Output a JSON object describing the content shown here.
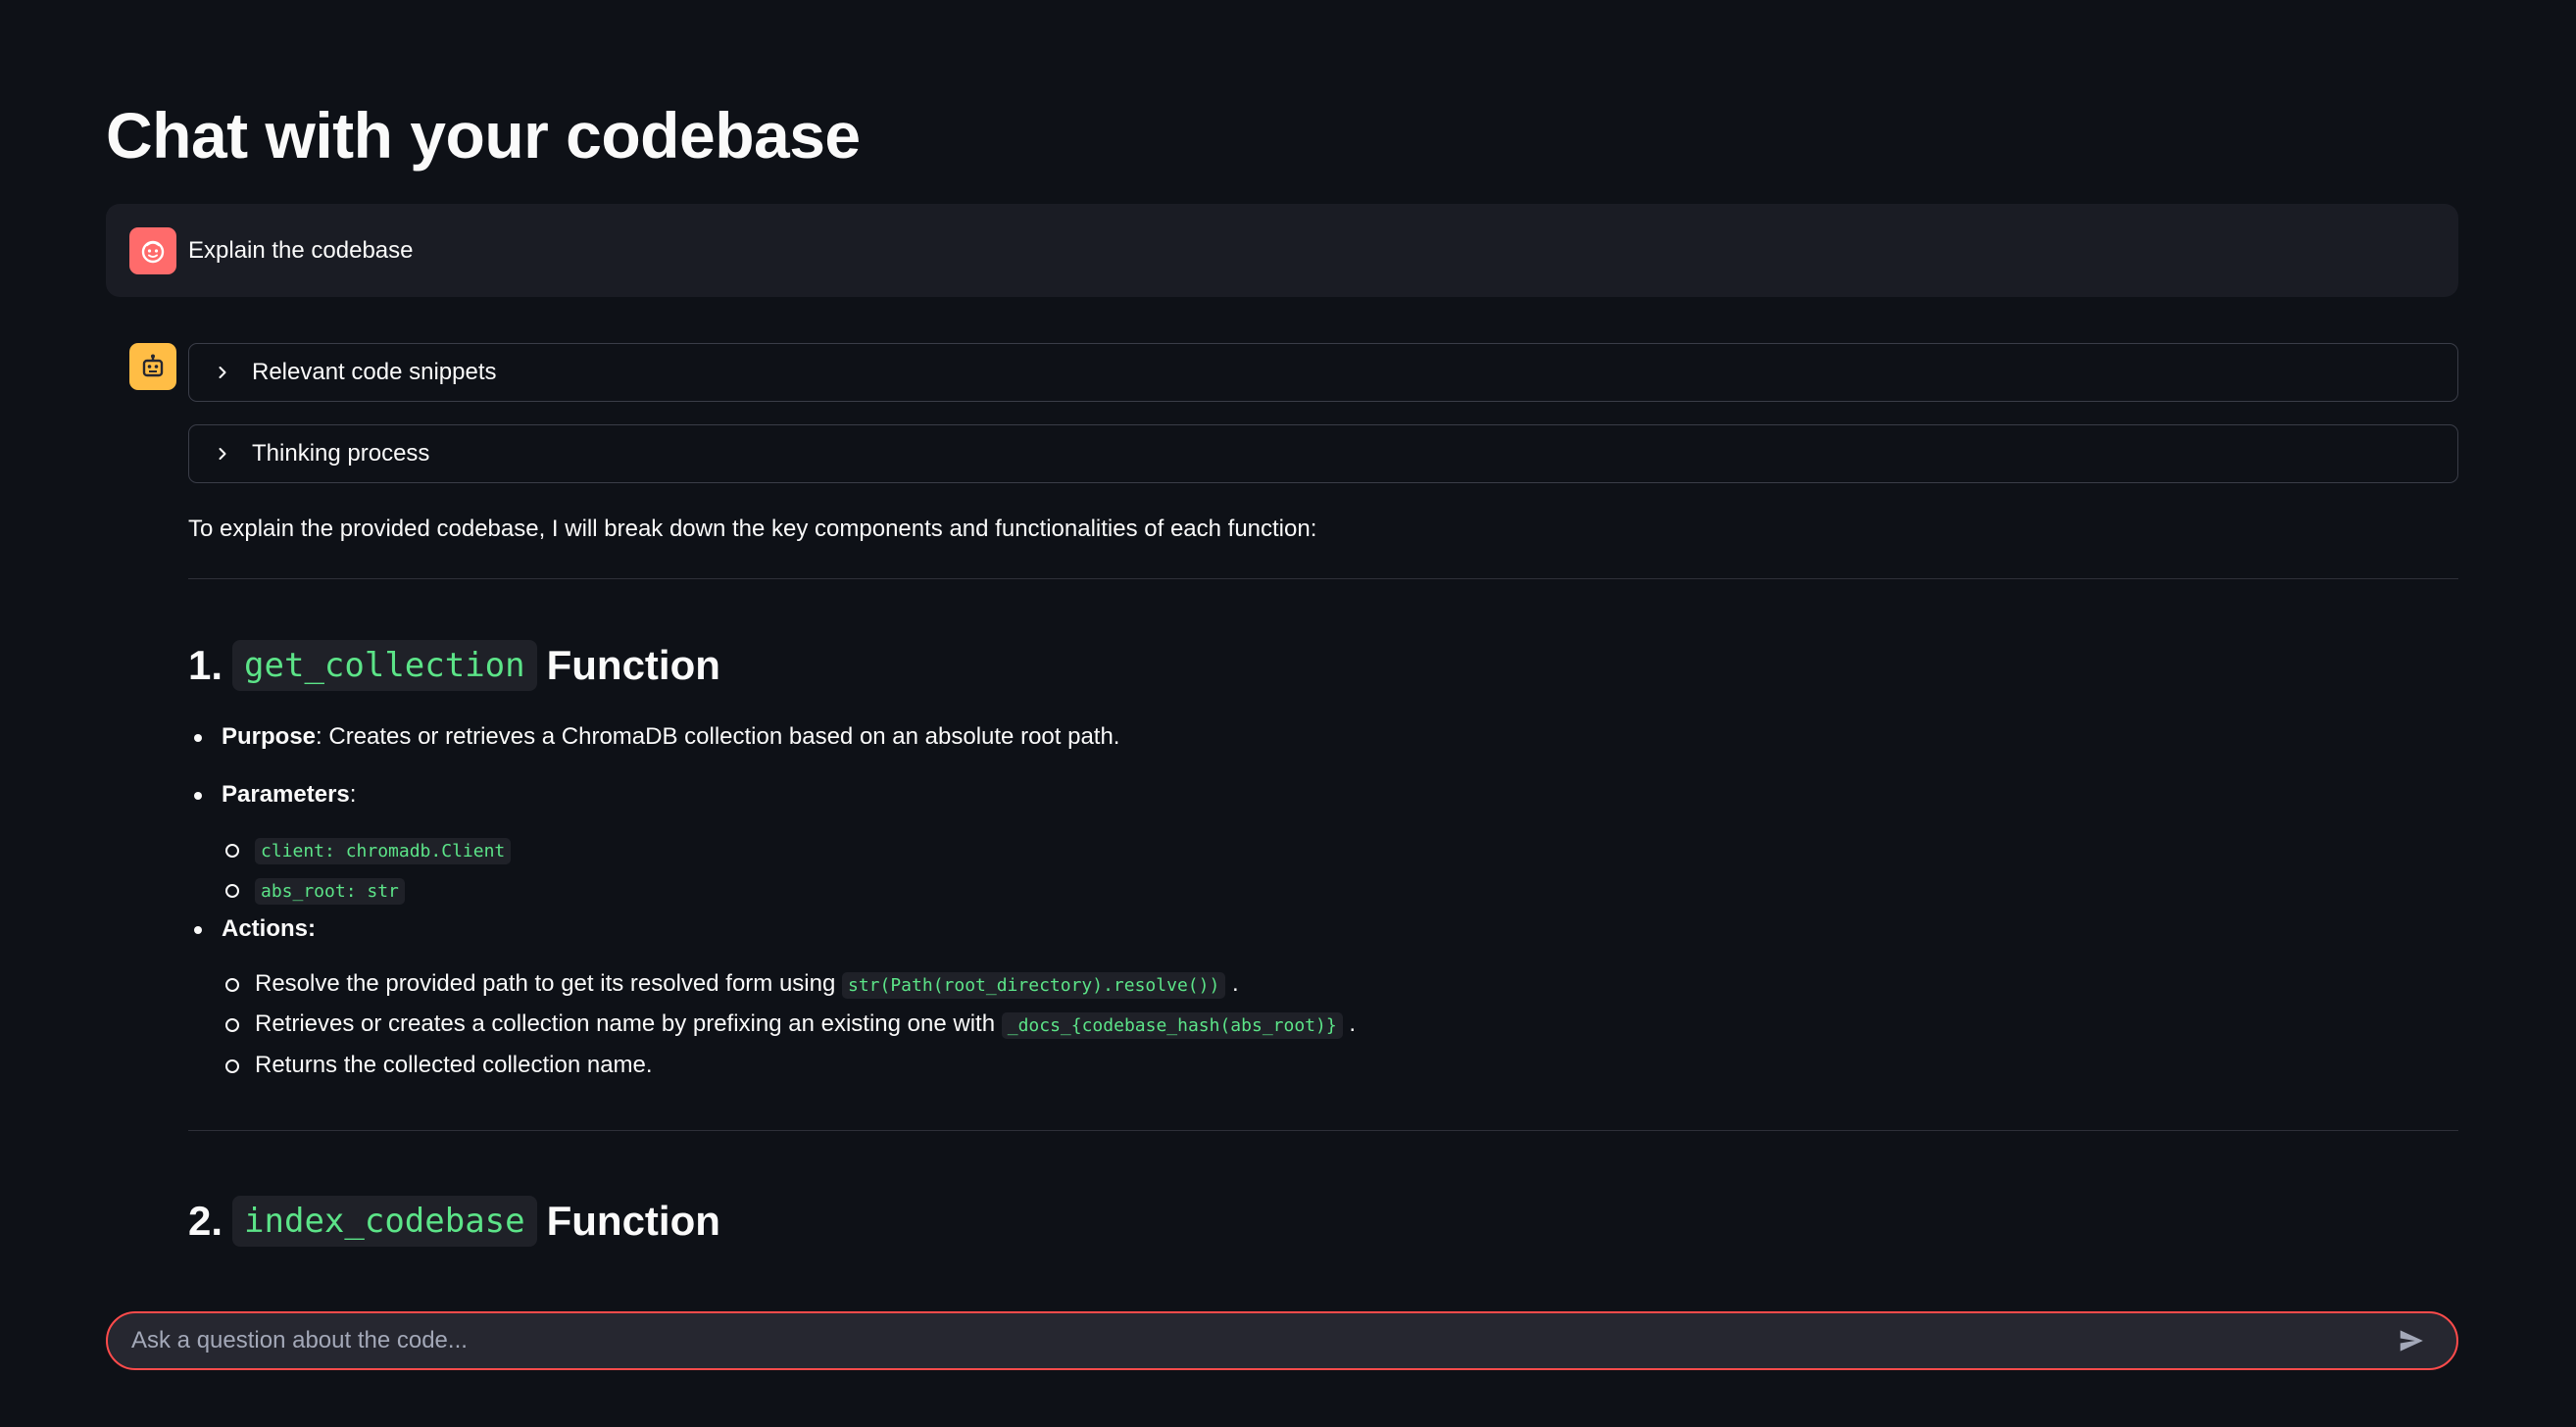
{
  "title": "Chat with your codebase",
  "user_message": {
    "avatar_icon": "user-face-icon",
    "text": "Explain the codebase"
  },
  "assistant": {
    "avatar_icon": "robot-icon",
    "expanders": [
      {
        "label": "Relevant code snippets"
      },
      {
        "label": "Thinking process"
      }
    ],
    "intro": "To explain the provided codebase, I will break down the key components and functionalities of each function:",
    "sections": [
      {
        "number": "1.",
        "func": "get_collection",
        "suffix": "Function",
        "purpose_label": "Purpose",
        "purpose_text": ": Creates or retrieves a ChromaDB collection based on an absolute root path.",
        "parameters_label": "Parameters",
        "parameters_colon": ":",
        "parameters": [
          "client: chromadb.Client",
          "abs_root: str"
        ],
        "actions_label": "Actions:",
        "actions": [
          {
            "text": "Resolve the provided path to get its resolved form using",
            "code": "str(Path(root_directory).resolve())",
            "end": "."
          },
          {
            "text": "Retrieves or creates a collection name by prefixing an existing one with",
            "code": "_docs_{codebase_hash(abs_root)}",
            "end": "."
          },
          {
            "text": "Returns the collected collection name."
          }
        ]
      },
      {
        "number": "2.",
        "func": "index_codebase",
        "suffix": "Function"
      }
    ]
  },
  "chat_input": {
    "placeholder": "Ask a question about the code...",
    "send_icon": "send-icon"
  },
  "colors": {
    "background": "#0e1117",
    "accent": "#ff4b4b",
    "code_green": "#5ce488",
    "user_avatar": "#ff6b6b",
    "assistant_avatar": "#ffbd45"
  }
}
